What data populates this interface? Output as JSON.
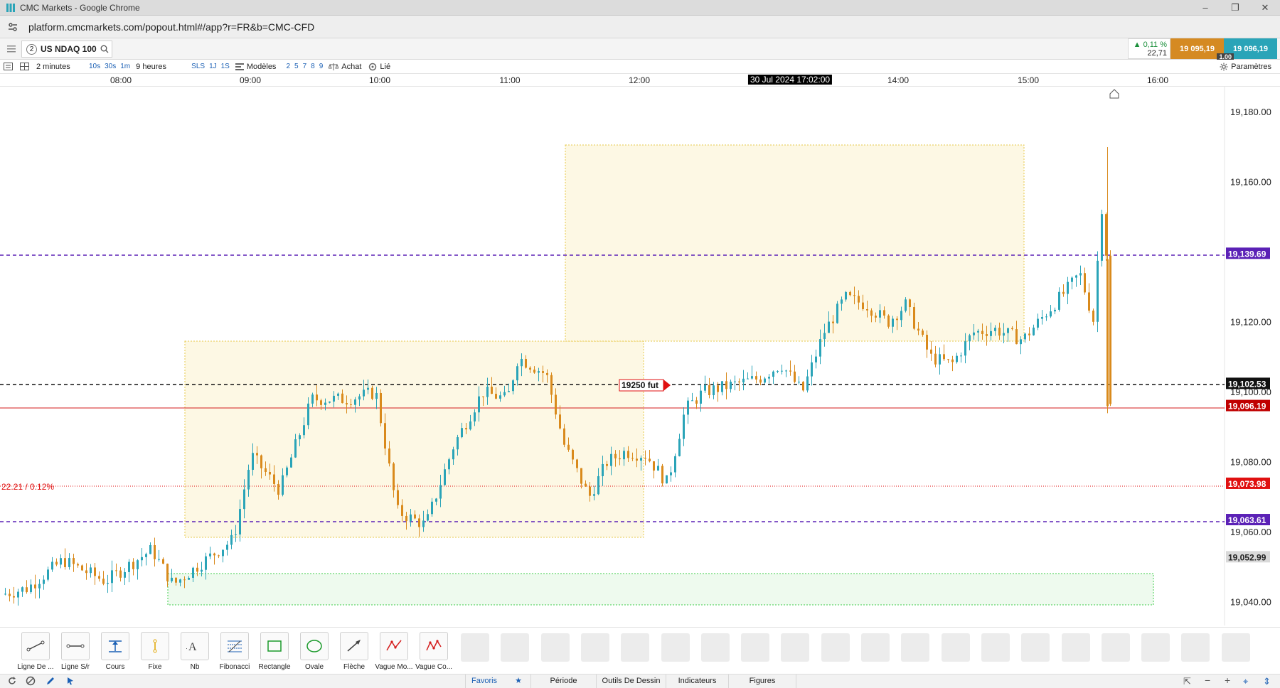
{
  "window": {
    "title": "CMC Markets - Google Chrome"
  },
  "browser": {
    "url": "platform.cmcmarkets.com/popout.html#/app?r=FR&b=CMC-CFD"
  },
  "header": {
    "instrument_number": "2",
    "instrument": "US NDAQ 100",
    "change_pct": "▲ 0,11 %",
    "change_pts": "22,71",
    "sell": "19 095,19",
    "buy": "19 096,19",
    "spread": "1.00"
  },
  "toolbar": {
    "timeframe": "2 minutes",
    "quick": [
      "10s",
      "30s",
      "1m"
    ],
    "range": "9 heures",
    "quick2": [
      "SLS",
      "1J",
      "1S"
    ],
    "templates": "Modèles",
    "nums": [
      "2",
      "5",
      "7",
      "8",
      "9"
    ],
    "buy": "Achat",
    "linked": "Lié",
    "settings": "Paramètres"
  },
  "time_axis": {
    "ticks": [
      "08:00",
      "09:00",
      "10:00",
      "11:00",
      "12:00",
      "14:00",
      "15:00",
      "16:00"
    ],
    "cursor": "30 Jul 2024 17:02:00"
  },
  "chart_data": {
    "type": "candlestick",
    "instrument": "US NDAQ 100",
    "timeframe": "2 minutes",
    "y_axis": {
      "ticks": [
        "19,180.00",
        "19,160.00",
        "19,120.00",
        "19,100.00",
        "19,080.00",
        "19,060.00",
        "19,040.00"
      ]
    },
    "price_tags": [
      {
        "label": "19,139.69",
        "value": 19139.69,
        "color": "#5b21b6",
        "line": "dashed-purple"
      },
      {
        "label": "19,102.53",
        "value": 19102.53,
        "color": "#111111",
        "line": "dashed-black"
      },
      {
        "label": "19,096.19",
        "value": 19096.19,
        "color": "#c00000",
        "line": "solid-red"
      },
      {
        "label": "19,073.98",
        "value": 19073.98,
        "color": "#e01010",
        "line": "dotted-red"
      },
      {
        "label": "19,063.61",
        "value": 19063.61,
        "color": "#5b21b6",
        "line": "dashed-purple"
      },
      {
        "label": "19,052.99",
        "value": 19052.99,
        "color": "#d9d9d9",
        "line": "none"
      }
    ],
    "annotations": {
      "change_label": "22.21 / 0.12%",
      "order_label": "19250 fut"
    },
    "colors": {
      "up": "#2aa4b8",
      "down": "#d98a1c"
    }
  },
  "tools": [
    {
      "label": "Ligne De ...",
      "icon": "trend-line-icon"
    },
    {
      "label": "Ligne S/r",
      "icon": "horizontal-line-icon"
    },
    {
      "label": "Cours",
      "icon": "price-icon"
    },
    {
      "label": "Fixe",
      "icon": "vertical-line-icon"
    },
    {
      "label": "Nb",
      "icon": "text-icon"
    },
    {
      "label": "Fibonacci",
      "icon": "fibonacci-icon"
    },
    {
      "label": "Rectangle",
      "icon": "rectangle-icon"
    },
    {
      "label": "Ovale",
      "icon": "ellipse-icon"
    },
    {
      "label": "Flèche",
      "icon": "arrow-icon"
    },
    {
      "label": "Vague Mo...",
      "icon": "wave-icon"
    },
    {
      "label": "Vague Co...",
      "icon": "corrective-wave-icon"
    }
  ],
  "bottom_tabs": [
    "Favoris",
    "Période",
    "Outils De Dessin",
    "Indicateurs",
    "Figures"
  ]
}
